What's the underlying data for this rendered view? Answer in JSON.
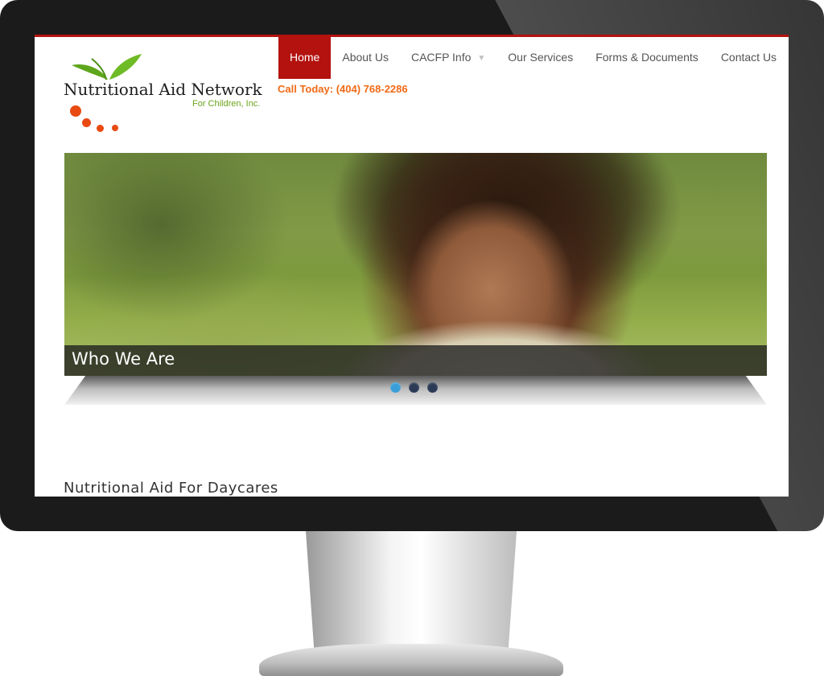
{
  "logo": {
    "name": "Nutritional Aid Network",
    "subtitle": "For Children, Inc."
  },
  "nav": {
    "items": [
      {
        "label": "Home",
        "active": true
      },
      {
        "label": "About Us"
      },
      {
        "label": "CACFP Info",
        "has_dropdown": true
      },
      {
        "label": "Our Services"
      },
      {
        "label": "Forms & Documents"
      },
      {
        "label": "Contact Us"
      }
    ],
    "call": "Call Today: (404) 768-2286"
  },
  "slider": {
    "caption": "Who We Are",
    "slide_count": 3,
    "active_slide": 1
  },
  "content": {
    "section_title": "Nutritional Aid For Daycares"
  },
  "colors": {
    "accent_red": "#b3120f",
    "call_orange": "#f06a16",
    "logo_green": "#6aa41a",
    "dot_orange": "#e84a12",
    "slider_dot_active": "#3a9fd8"
  }
}
